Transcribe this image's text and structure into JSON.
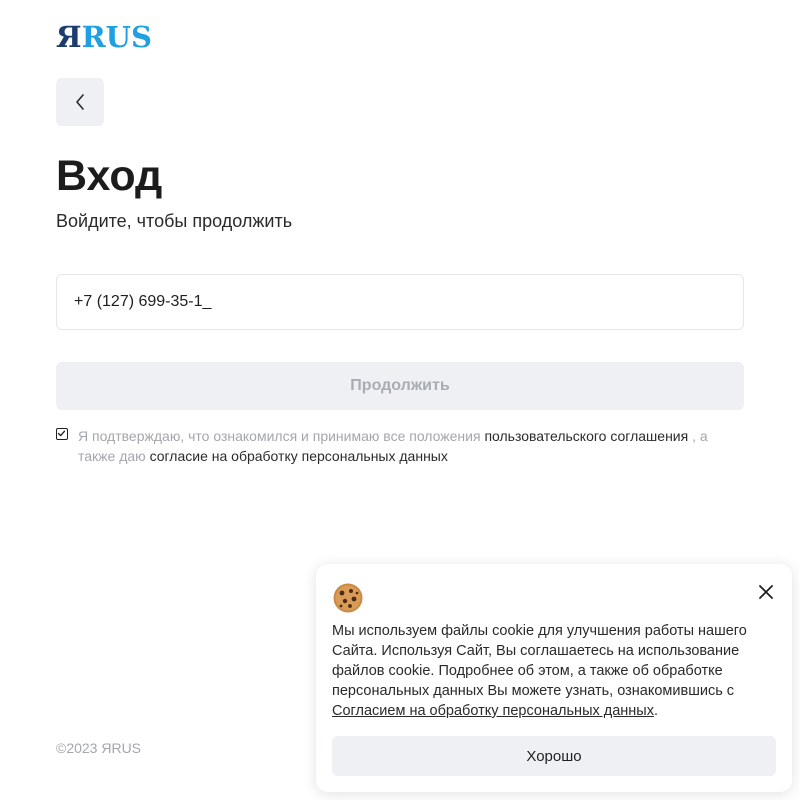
{
  "header": {
    "logo_ya": "Я",
    "logo_rus": "RUS"
  },
  "login": {
    "back_icon": "chevron-left-icon",
    "title": "Вход",
    "subtitle": "Войдите, чтобы продолжить",
    "phone_value": "+7 (127) 699-35-1_",
    "continue_label": "Продолжить",
    "consent": {
      "checked": true,
      "text_1": "Я подтверждаю, что ознакомился и принимаю все положения ",
      "link_1": "пользовательского соглашения",
      "text_2": " , а также даю ",
      "link_2": "согласие на обработку персональных данных"
    }
  },
  "footer": {
    "copyright": "©2023 ЯRUS"
  },
  "cookie_banner": {
    "icon": "cookie-icon",
    "close_icon": "close-icon",
    "text": "Мы используем файлы cookie для улучшения работы нашего Сайта. Используя Сайт, Вы соглашаетесь на использование файлов cookie. Подробнее об этом, а также об обработке персональных данных Вы можете узнать, ознакомившись с ",
    "link": "Согласием на обработку персональных данных",
    "text_end": ".",
    "ok_label": "Хорошо"
  },
  "colors": {
    "logo_dark": "#1d3b6e",
    "logo_light": "#1ea0e3",
    "button_bg": "#eef0f4",
    "muted_text": "#a3a6ab"
  }
}
